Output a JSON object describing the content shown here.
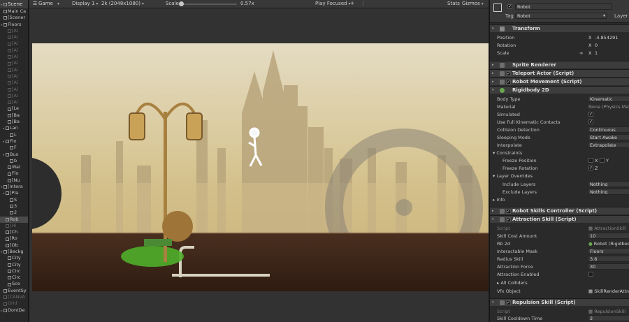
{
  "hierarchy": {
    "title": "Scene",
    "rows": [
      {
        "label": "Main Ca",
        "indent": 0,
        "dim": false,
        "arrow": ""
      },
      {
        "label": "[Scener",
        "indent": 0,
        "dim": false,
        "arrow": ""
      },
      {
        "label": "Floors",
        "indent": 0,
        "dim": false,
        "arrow": "▾"
      },
      {
        "label": "[Al",
        "indent": 2,
        "dim": true,
        "arrow": ""
      },
      {
        "label": "[Al",
        "indent": 2,
        "dim": true,
        "arrow": ""
      },
      {
        "label": "[Al",
        "indent": 2,
        "dim": true,
        "arrow": ""
      },
      {
        "label": "[Al",
        "indent": 2,
        "dim": true,
        "arrow": ""
      },
      {
        "label": "[Al",
        "indent": 2,
        "dim": true,
        "arrow": ""
      },
      {
        "label": "[Al",
        "indent": 2,
        "dim": true,
        "arrow": ""
      },
      {
        "label": "[Al",
        "indent": 2,
        "dim": true,
        "arrow": ""
      },
      {
        "label": "[Al",
        "indent": 2,
        "dim": true,
        "arrow": ""
      },
      {
        "label": "[Al",
        "indent": 2,
        "dim": true,
        "arrow": ""
      },
      {
        "label": "[Al",
        "indent": 2,
        "dim": true,
        "arrow": ""
      },
      {
        "label": "[Al",
        "indent": 2,
        "dim": true,
        "arrow": ""
      },
      {
        "label": "[Al",
        "indent": 2,
        "dim": true,
        "arrow": ""
      },
      {
        "label": "[Le",
        "indent": 2,
        "dim": false,
        "arrow": ""
      },
      {
        "label": "[Ba",
        "indent": 2,
        "dim": false,
        "arrow": ""
      },
      {
        "label": "[Ba",
        "indent": 2,
        "dim": false,
        "arrow": ""
      },
      {
        "label": "Lan",
        "indent": 1,
        "dim": false,
        "arrow": "▾"
      },
      {
        "label": "L",
        "indent": 3,
        "dim": false,
        "arrow": ""
      },
      {
        "label": "Flo",
        "indent": 1,
        "dim": false,
        "arrow": "▾"
      },
      {
        "label": "F",
        "indent": 3,
        "dim": false,
        "arrow": ""
      },
      {
        "label": "Bus",
        "indent": 1,
        "dim": false,
        "arrow": "▾"
      },
      {
        "label": "b",
        "indent": 3,
        "dim": false,
        "arrow": ""
      },
      {
        "label": "Wal",
        "indent": 2,
        "dim": false,
        "arrow": ""
      },
      {
        "label": "Flo",
        "indent": 2,
        "dim": false,
        "arrow": ""
      },
      {
        "label": "[Nu",
        "indent": 2,
        "dim": false,
        "arrow": ""
      },
      {
        "label": "[Intera",
        "indent": 0,
        "dim": false,
        "arrow": "▾"
      },
      {
        "label": "[Pla",
        "indent": 1,
        "dim": false,
        "arrow": "▾"
      },
      {
        "label": "S",
        "indent": 3,
        "dim": false,
        "arrow": ""
      },
      {
        "label": "3",
        "indent": 3,
        "dim": false,
        "arrow": ""
      },
      {
        "label": "2",
        "indent": 3,
        "dim": false,
        "arrow": ""
      },
      {
        "label": "Rob",
        "indent": 1,
        "dim": false,
        "arrow": "",
        "selected": true
      },
      {
        "label": "[Hi",
        "indent": 1,
        "dim": true,
        "arrow": ""
      },
      {
        "label": "[Ch",
        "indent": 1,
        "dim": false,
        "arrow": ""
      },
      {
        "label": "[Ro",
        "indent": 1,
        "dim": false,
        "arrow": ""
      },
      {
        "label": "[Ob",
        "indent": 1,
        "dim": false,
        "arrow": ""
      },
      {
        "label": "[Backg",
        "indent": 0,
        "dim": false,
        "arrow": "▾"
      },
      {
        "label": "City",
        "indent": 2,
        "dim": false,
        "arrow": ""
      },
      {
        "label": "City",
        "indent": 2,
        "dim": false,
        "arrow": ""
      },
      {
        "label": "Circ",
        "indent": 2,
        "dim": false,
        "arrow": ""
      },
      {
        "label": "Circ",
        "indent": 2,
        "dim": false,
        "arrow": ""
      },
      {
        "label": "Sce",
        "indent": 2,
        "dim": false,
        "arrow": ""
      },
      {
        "label": "EventSy",
        "indent": 0,
        "dim": false,
        "arrow": ""
      },
      {
        "label": "[CANVA",
        "indent": 0,
        "dim": true,
        "arrow": ""
      },
      {
        "label": "Grid",
        "indent": 0,
        "dim": true,
        "arrow": ""
      },
      {
        "label": "DontDe",
        "indent": 0,
        "dim": false,
        "arrow": "▸"
      }
    ]
  },
  "game_toolbar": {
    "view": "Game",
    "display": "Display 1",
    "resolution": "2k (2048x1080)",
    "scale_label": "Scale",
    "scale_value": "0.57x",
    "scale_fraction": 0.05,
    "play_mode": "Play Focused",
    "stats": "Stats",
    "gizmos": "Gizmos"
  },
  "inspector": {
    "object_name": "Robot",
    "tag_label": "Tag",
    "tag_value": "Robot",
    "layer_label": "Layer",
    "components": {
      "transform": "Transform",
      "sprite_renderer": "Sprite Renderer",
      "teleport_actor": "Teleport Actor (Script)",
      "robot_movement": "Robot Movement (Script)",
      "rigidbody": "Rigidbody 2D",
      "skills_controller": "Robot Skills Controller (Script)",
      "attraction_skill": "Attraction Skill (Script)",
      "repulsion_skill": "Repulsion Skill (Script)"
    },
    "transform": {
      "position_label": "Position",
      "position_x": "-4.854291",
      "rotation_label": "Rotation",
      "rotation_x": "0",
      "scale_label": "Scale",
      "scale_x": "1",
      "scale_prefix": "∞"
    },
    "rigidbody": {
      "body_type_label": "Body Type",
      "body_type": "Kinematic",
      "material_label": "Material",
      "material": "None (Physics Mat",
      "simulated_label": "Simulated",
      "full_kinematic_label": "Use Full Kinematic Contacts",
      "collision_label": "Collision Detection",
      "collision": "Continuous",
      "sleeping_label": "Sleeping Mode",
      "sleeping": "Start Awake",
      "interpolate_label": "Interpolate",
      "interpolate": "Extrapolate",
      "constraints_label": "Constraints",
      "freeze_pos_label": "Freeze Position",
      "freeze_pos_x": "X",
      "freeze_pos_y": "Y",
      "freeze_rot_label": "Freeze Rotation",
      "freeze_rot_z": "Z",
      "layer_overrides_label": "Layer Overrides",
      "include_layers_label": "Include Layers",
      "include_layers": "Nothing",
      "exclude_layers_label": "Exclude Layers",
      "exclude_layers": "Nothing",
      "info_label": "Info"
    },
    "attraction": {
      "script_label": "Script",
      "script": "AttractionSkill",
      "cost_label": "Skill Cost Amount",
      "cost": "10",
      "rb_label": "Rb 2d",
      "rb": "Robot (Rigidbod",
      "mask_label": "Interactable Mask",
      "mask": "Floors",
      "radius_label": "Radius Skill",
      "radius": "3.6",
      "force_label": "Attraction Force",
      "force": "30",
      "enabled_label": "Attraction Enabled",
      "colliders_label": "All Colliders",
      "vfx_label": "Vfx Object",
      "vfx": "SkillRenderAttra"
    },
    "repulsion": {
      "script_label": "Script",
      "script": "RepulsionSkill",
      "cooldown_label": "Skill Cooldown Time",
      "cooldown": "2"
    }
  },
  "colors": {
    "editor_bg": "#1e1e1e",
    "panel_bg": "#2a2a2a",
    "sky": "#d9cba3",
    "floor": "#3b2519",
    "skill_circle": "#56b22d"
  }
}
